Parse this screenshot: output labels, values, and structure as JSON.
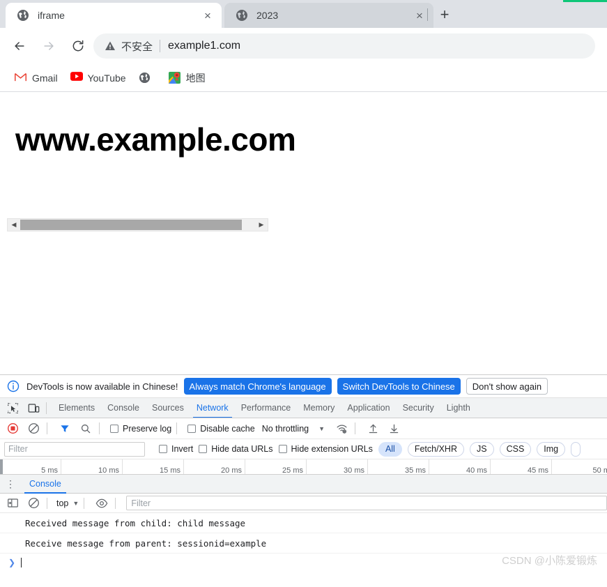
{
  "browser": {
    "tabs": [
      {
        "title": "iframe",
        "favicon": "globe-icon",
        "active": true,
        "close_label": "×"
      },
      {
        "title": "2023",
        "favicon": "globe-icon",
        "active": false,
        "close_label": "×"
      }
    ],
    "new_tab_label": "+",
    "nav": {
      "back_label": "←",
      "forward_label": "→",
      "reload_label": "⟳"
    },
    "omnibox": {
      "security_icon": "warning-triangle-icon",
      "security_text": "不安全",
      "url": "example1.com"
    },
    "bookmarks": [
      {
        "label": "Gmail",
        "icon": "gmail-icon"
      },
      {
        "label": "YouTube",
        "icon": "youtube-icon"
      },
      {
        "label": "",
        "icon": "globe-icon"
      },
      {
        "label": "地图",
        "icon": "google-maps-icon"
      }
    ]
  },
  "page": {
    "heading": "www.example.com",
    "scrollbar": {
      "left_arrow": "◀",
      "right_arrow": "▶"
    }
  },
  "devtools": {
    "notice": {
      "icon": "info-icon",
      "message": "DevTools is now available in Chinese!",
      "buttons": [
        {
          "label": "Always match Chrome's language",
          "style": "primary"
        },
        {
          "label": "Switch DevTools to Chinese",
          "style": "primary"
        },
        {
          "label": "Don't show again",
          "style": "secondary"
        }
      ]
    },
    "toolbar_icons": [
      {
        "name": "inspect-element-icon"
      },
      {
        "name": "device-toolbar-icon"
      }
    ],
    "panels": [
      {
        "label": "Elements",
        "selected": false
      },
      {
        "label": "Console",
        "selected": false
      },
      {
        "label": "Sources",
        "selected": false
      },
      {
        "label": "Network",
        "selected": true
      },
      {
        "label": "Performance",
        "selected": false
      },
      {
        "label": "Memory",
        "selected": false
      },
      {
        "label": "Application",
        "selected": false
      },
      {
        "label": "Security",
        "selected": false
      },
      {
        "label": "Lighth",
        "selected": false
      }
    ],
    "network": {
      "record_icon": "record-icon",
      "clear_icon": "clear-icon",
      "filter_icon": "funnel-icon",
      "search_icon": "search-icon",
      "preserve_log_label": "Preserve log",
      "disable_cache_label": "Disable cache",
      "throttling_value": "No throttling",
      "throttling_caret": "▼",
      "wifi_icon": "network-conditions-icon",
      "import_icon": "import-har-icon",
      "export_icon": "export-har-icon",
      "filter_placeholder": "Filter",
      "invert_label": "Invert",
      "hide_data_urls_label": "Hide data URLs",
      "hide_extension_urls_label": "Hide extension URLs",
      "type_chips": [
        {
          "label": "All",
          "active": true
        },
        {
          "label": "Fetch/XHR",
          "active": false
        },
        {
          "label": "JS",
          "active": false
        },
        {
          "label": "CSS",
          "active": false
        },
        {
          "label": "Img",
          "active": false
        },
        {
          "label": "",
          "active": false
        }
      ],
      "timeline_ticks": [
        "5 ms",
        "10 ms",
        "15 ms",
        "20 ms",
        "25 ms",
        "30 ms",
        "35 ms",
        "40 ms",
        "45 ms",
        "50 m"
      ]
    },
    "drawer": {
      "kebab_label": "⋮",
      "tab_label": "Console",
      "sidebar_icon": "show-console-sidebar-icon",
      "clear_icon": "clear-console-icon",
      "context": "top",
      "context_caret": "▼",
      "eye_icon": "live-expression-icon",
      "filter_placeholder": "Filter",
      "messages": [
        "Received message from child: child message",
        "Receive message from parent: sessionid=example"
      ],
      "prompt_caret": "❯"
    }
  },
  "watermark": "CSDN @小陈爱锻炼",
  "colors": {
    "accent_blue": "#1a73e8",
    "chrome_tabstrip": "#dee1e6",
    "green_bar": "#0fc678",
    "record_red": "#e53935"
  }
}
